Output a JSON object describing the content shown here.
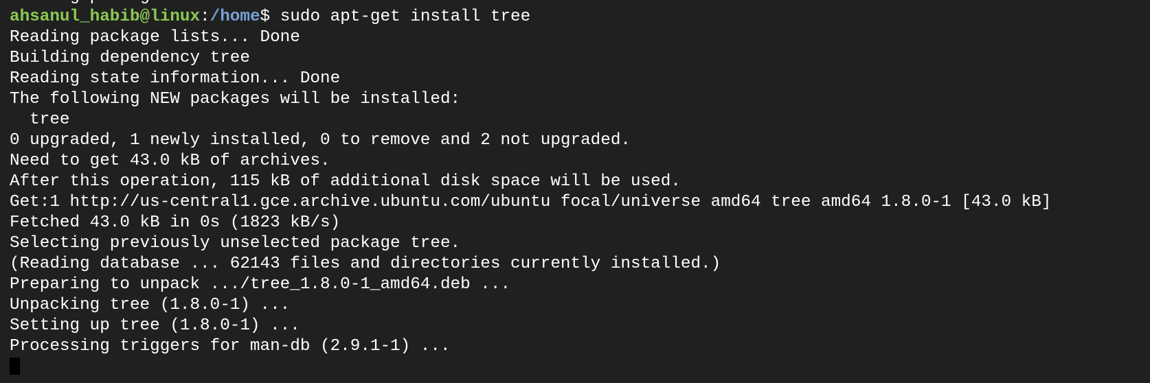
{
  "terminal": {
    "previous_line": "Reading package lists... Done",
    "prompt": {
      "user_host": "ahsanul_habib@linux",
      "separator": ":",
      "path": "/home",
      "symbol": "$",
      "command": " sudo apt-get install tree"
    },
    "output_lines": [
      "Reading package lists... Done",
      "Building dependency tree",
      "Reading state information... Done",
      "The following NEW packages will be installed:",
      "  tree",
      "0 upgraded, 1 newly installed, 0 to remove and 2 not upgraded.",
      "Need to get 43.0 kB of archives.",
      "After this operation, 115 kB of additional disk space will be used.",
      "Get:1 http://us-central1.gce.archive.ubuntu.com/ubuntu focal/universe amd64 tree amd64 1.8.0-1 [43.0 kB]",
      "Fetched 43.0 kB in 0s (1823 kB/s)",
      "Selecting previously unselected package tree.",
      "(Reading database ... 62143 files and directories currently installed.)",
      "Preparing to unpack .../tree_1.8.0-1_amd64.deb ...",
      "Unpacking tree (1.8.0-1) ...",
      "Setting up tree (1.8.0-1) ...",
      "Processing triggers for man-db (2.9.1-1) ..."
    ]
  },
  "colors": {
    "background": "#202020",
    "text": "#ffffff",
    "prompt_user": "#8ac951",
    "prompt_path": "#77a0d6",
    "cursor": "#000000"
  }
}
